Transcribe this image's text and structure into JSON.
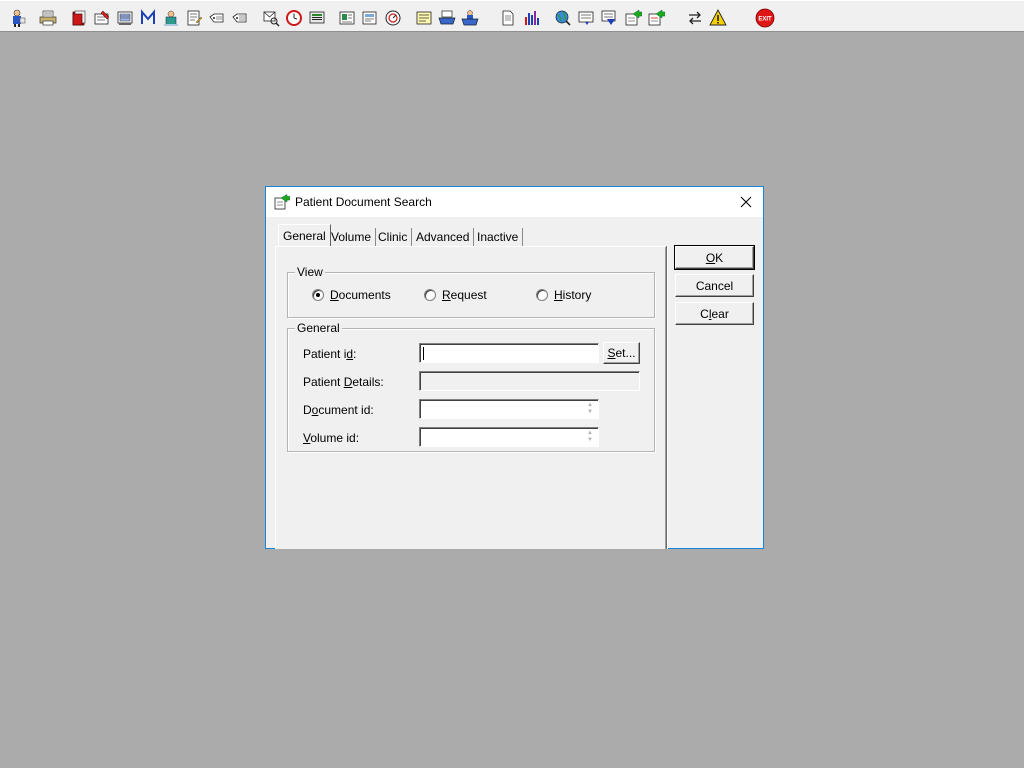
{
  "toolbar": {
    "buttons": [
      {
        "icon": "user-admin-icon"
      },
      {
        "icon": "printer-icon"
      },
      {
        "icon": "red-book-icon"
      },
      {
        "icon": "folder-edit-icon"
      },
      {
        "icon": "scanner-icon"
      },
      {
        "icon": "mail-m-icon"
      },
      {
        "icon": "doctor-icon"
      },
      {
        "icon": "form-edit-icon"
      },
      {
        "icon": "tag-icon"
      },
      {
        "icon": "tag-alt-icon"
      },
      {
        "icon": "envelope-search-icon"
      },
      {
        "icon": "clock-icon"
      },
      {
        "icon": "monitor-icon"
      },
      {
        "icon": "id-card-icon"
      },
      {
        "icon": "document-check-icon"
      },
      {
        "icon": "gauge-icon"
      },
      {
        "icon": "note-icon"
      },
      {
        "icon": "tray-icon"
      },
      {
        "icon": "tray-user-icon"
      },
      {
        "icon": "page-icon"
      },
      {
        "icon": "bar-chart-icon"
      },
      {
        "icon": "globe-search-icon"
      },
      {
        "icon": "form-list-icon"
      },
      {
        "icon": "form-down-icon"
      },
      {
        "icon": "document-green-arrow-icon"
      },
      {
        "icon": "document-green-arrow-alt-icon"
      },
      {
        "icon": "swap-arrows-icon"
      },
      {
        "icon": "warning-icon"
      },
      {
        "icon": "exit-icon",
        "label": "EXIT"
      }
    ]
  },
  "dialog": {
    "title": "Patient Document Search",
    "tabs": [
      {
        "label": "General",
        "active": true
      },
      {
        "label": "Volume",
        "active": false
      },
      {
        "label": "Clinic",
        "active": false
      },
      {
        "label": "Advanced",
        "active": false
      },
      {
        "label": "Inactive",
        "active": false
      }
    ],
    "view_group": {
      "title": "View",
      "options": [
        {
          "label_pre": "",
          "label_mnemonic": "D",
          "label_post": "ocuments",
          "checked": true
        },
        {
          "label_pre": "",
          "label_mnemonic": "R",
          "label_post": "equest",
          "checked": false
        },
        {
          "label_pre": "",
          "label_mnemonic": "H",
          "label_post": "istory",
          "checked": false
        }
      ]
    },
    "general_group": {
      "title": "General",
      "patient_id": {
        "label_pre": "Patient i",
        "label_mnemonic": "d",
        "label_post": ":",
        "value": ""
      },
      "set_button": {
        "label_mnemonic": "S",
        "label_post": "et..."
      },
      "patient_details": {
        "label_pre": "Patient ",
        "label_mnemonic": "D",
        "label_post": "etails:",
        "value": ""
      },
      "document_id": {
        "label_pre": "D",
        "label_mnemonic": "o",
        "label_post": "cument id:",
        "value": ""
      },
      "volume_id": {
        "label_pre": "",
        "label_mnemonic": "V",
        "label_post": "olume id:",
        "value": ""
      }
    },
    "buttons": {
      "ok": {
        "label_mnemonic": "O",
        "label_post": "K"
      },
      "cancel": {
        "label": "Cancel"
      },
      "clear": {
        "label_pre": "C",
        "label_mnemonic": "l",
        "label_post": "ear"
      }
    }
  }
}
